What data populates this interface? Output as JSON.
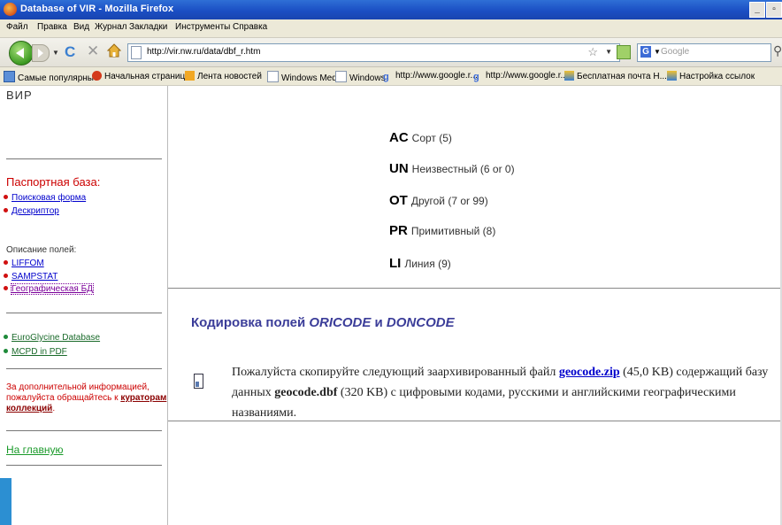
{
  "window": {
    "title": "Database of VIR - Mozilla Firefox"
  },
  "menu": [
    "Файл",
    "Правка",
    "Вид",
    "Журнал",
    "Закладки",
    "Инструменты",
    "Справка"
  ],
  "nav": {
    "url": "http://vir.nw.ru/data/dbf_r.htm",
    "search_placeholder": "Google"
  },
  "bookmarks": [
    "Самые популярные",
    "Начальная страница",
    "Лента новостей",
    "Windows Media",
    "Windows",
    "http://www.google.r...",
    "http://www.google.r...",
    "Бесплатная почта H...",
    "Настройка ссылок"
  ],
  "sidebar": {
    "header": "ВИР",
    "passport_title": "Паспортная база:",
    "passport_links": [
      "Поисковая форма",
      "Дескриптор"
    ],
    "fields_label": "Описание полей:",
    "field_links": [
      "LIFFOM",
      "SAMPSTAT",
      "Географическая БД"
    ],
    "external_links": [
      "EuroGlycine Database",
      "MCPD in PDF"
    ],
    "info_text": "За дополнительной информацией, пожалуйста обращайтесь к",
    "info_link": "кураторам коллекций",
    "info_end": ".",
    "home_link": "На главную"
  },
  "main": {
    "codes": [
      {
        "code": "AC",
        "desc": "Сорт (5)"
      },
      {
        "code": "UN",
        "desc": "Неизвестный (6 or 0)"
      },
      {
        "code": "OT",
        "desc": "Другой (7 or 99)"
      },
      {
        "code": "PR",
        "desc": "Примитивный (8)"
      },
      {
        "code": "LI",
        "desc": "Линия (9)"
      }
    ],
    "heading_prefix": "Кодировка полей ",
    "heading_f1": "ORICODE",
    "heading_and": " и ",
    "heading_f2": "DONCODE",
    "para_1": "Пожалуйста скопируйте следующий заархивированный файл ",
    "para_link": "geocode.zip",
    "para_2": " (45,0 KB) содержащий базу данных ",
    "para_bold": "geocode.dbf",
    "para_3": " (320 KB) с цифровыми кодами, русскими и английскими географическими названиями."
  }
}
